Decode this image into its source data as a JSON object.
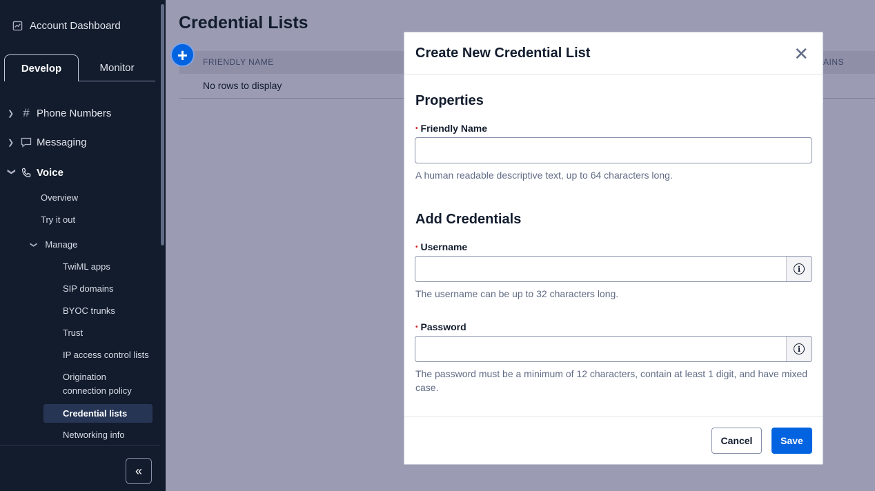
{
  "sidebar": {
    "account_dashboard": "Account Dashboard",
    "tabs": [
      {
        "label": "Develop",
        "active": true
      },
      {
        "label": "Monitor",
        "active": false
      }
    ],
    "nav": [
      {
        "label": "Phone Numbers",
        "icon": "hash-icon",
        "expanded": false
      },
      {
        "label": "Messaging",
        "icon": "chat-icon",
        "expanded": false
      },
      {
        "label": "Voice",
        "icon": "phone-icon",
        "expanded": true
      }
    ],
    "voice_items": {
      "overview": "Overview",
      "try_it_out": "Try it out",
      "manage": "Manage",
      "twiml_apps": "TwiML apps",
      "sip_domains": "SIP domains",
      "byoc_trunks": "BYOC trunks",
      "trust": "Trust",
      "ip_access": "IP access control lists",
      "origination_1": "Origination",
      "origination_2": "connection policy",
      "credential_lists": "Credential lists",
      "networking_info": "Networking info"
    },
    "collapse_icon": "double-chevron-left-icon"
  },
  "main": {
    "title": "Credential Lists",
    "add_icon": "plus-icon",
    "columns": [
      "FRIENDLY NAME",
      "AINS"
    ],
    "empty_text": "No rows to display"
  },
  "modal": {
    "title": "Create New Credential List",
    "close_icon": "close-icon",
    "properties_heading": "Properties",
    "friendly_name_label": "Friendly Name",
    "friendly_name_help": "A human readable descriptive text, up to 64 characters long.",
    "add_credentials_heading": "Add Credentials",
    "username_label": "Username",
    "username_help": "The username can be up to 32 characters long.",
    "password_label": "Password",
    "password_help": "The password must be a minimum of 12 characters, contain at least 1 digit, and have mixed case.",
    "info_icon": "info-icon",
    "cancel_label": "Cancel",
    "save_label": "Save",
    "required_marker": "•"
  },
  "colors": {
    "primary": "#0263e0",
    "sidebar_bg": "#121c2d",
    "overlay": "#9b9bb3",
    "required": "#d61f1f"
  }
}
